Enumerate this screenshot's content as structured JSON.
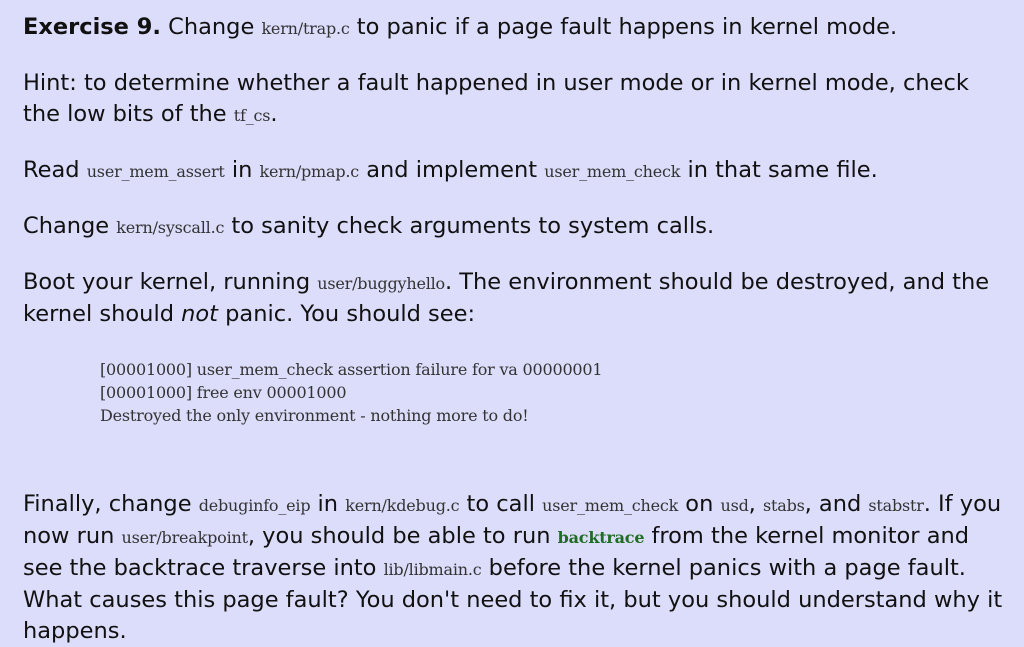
{
  "exercise": {
    "title": "Exercise 9.",
    "t1": " Change ",
    "c1": "kern/trap.c",
    "t2": " to panic if a page fault happens in kernel mode."
  },
  "hint": {
    "t1": "Hint: to determine whether a fault happened in user mode or in kernel mode, check the low bits of the ",
    "c1": "tf_cs",
    "t2": "."
  },
  "read": {
    "t1": "Read ",
    "c1": "user_mem_assert",
    "t2": " in ",
    "c2": "kern/pmap.c",
    "t3": " and implement ",
    "c3": "user_mem_check",
    "t4": " in that same file."
  },
  "change": {
    "t1": "Change ",
    "c1": "kern/syscall.c",
    "t2": " to sanity check arguments to system calls."
  },
  "boot": {
    "t1": "Boot your kernel, running ",
    "c1": "user/buggyhello",
    "t2": ". The environment should be destroyed, and the kernel should ",
    "em": "not",
    "t3": " panic. You should see:"
  },
  "output": {
    "line1": "[00001000] user_mem_check assertion failure for va 00000001",
    "line2": "[00001000] free env 00001000",
    "line3": "Destroyed the only environment - nothing more to do!"
  },
  "finally": {
    "t1": "Finally, change ",
    "c1": "debuginfo_eip",
    "t2": " in ",
    "c2": "kern/kdebug.c",
    "t3": " to call ",
    "c3": "user_mem_check",
    "t4": " on ",
    "c4": "usd",
    "t5": ", ",
    "c5": "stabs",
    "t6": ", and ",
    "c6": "stabstr",
    "t7": ". If you now run ",
    "c7": "user/breakpoint",
    "t8": ", you should be able to run ",
    "c8": "backtrace",
    "t9": " from the kernel monitor and see the backtrace traverse into ",
    "c9": "lib/libmain.c",
    "t10": " before the kernel panics with a page fault. What causes this page fault? You don't need to fix it, but you should understand why it happens."
  },
  "colors": {
    "background": "#dcdcfb",
    "text": "#111111",
    "code": "#333333",
    "command": "#1f6d24"
  }
}
